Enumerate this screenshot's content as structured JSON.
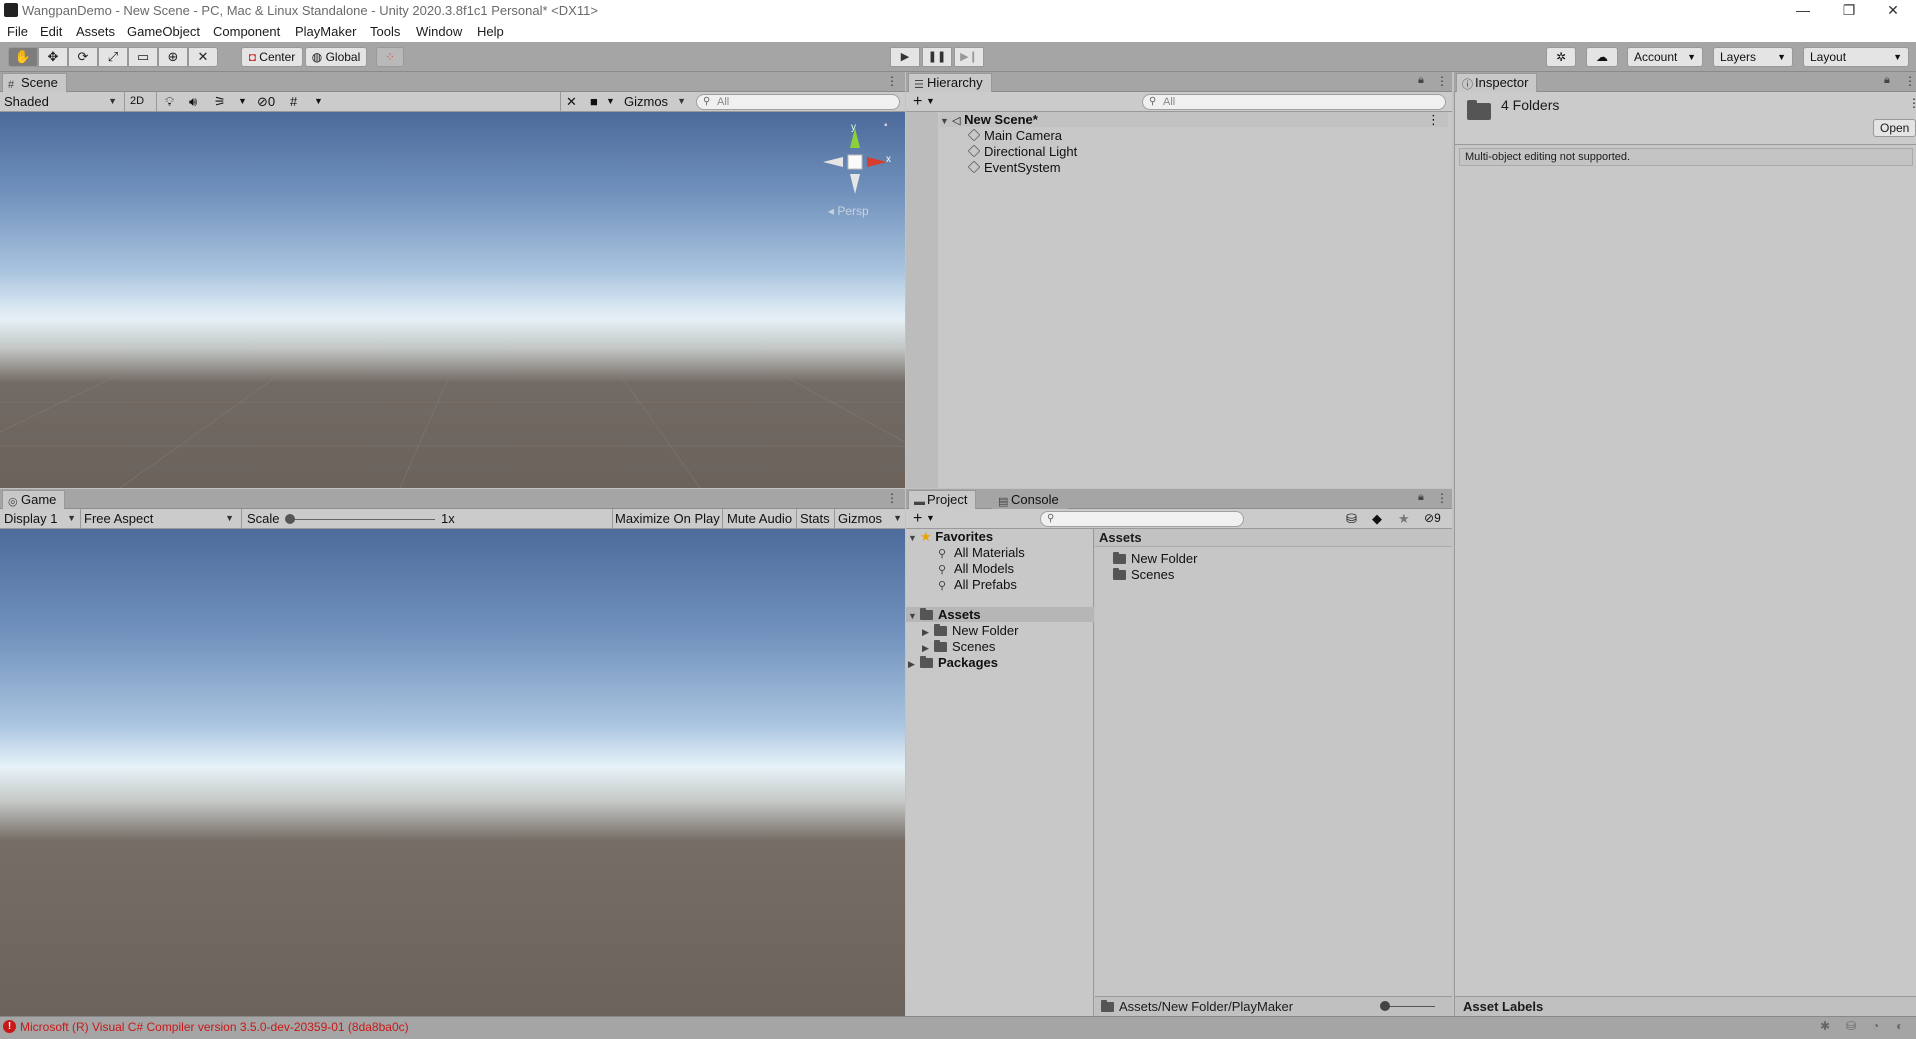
{
  "window": {
    "title": "WangpanDemo - New Scene - PC, Mac & Linux Standalone - Unity 2020.3.8f1c1 Personal* <DX11>",
    "minimize": "—",
    "restore": "❐",
    "close": "✕"
  },
  "menu": [
    "File",
    "Edit",
    "Assets",
    "GameObject",
    "Component",
    "PlayMaker",
    "Tools",
    "Window",
    "Help"
  ],
  "toolbar": {
    "tools": [
      "hand-icon",
      "move-icon",
      "rotate-icon",
      "scale-icon",
      "rect-icon",
      "transform-icon",
      "custom-tool-icon"
    ],
    "pivot_label": "Center",
    "space_label": "Global",
    "account_label": "Account",
    "layers_label": "Layers",
    "layout_label": "Layout"
  },
  "scene": {
    "tab_label": "Scene",
    "shading_mode": "Shaded",
    "mode_2d": "2D",
    "hidden_count": "0",
    "gizmos_label": "Gizmos",
    "search_placeholder": "All",
    "persp_label": "Persp",
    "axis_y": "y",
    "axis_x": "x"
  },
  "game": {
    "tab_label": "Game",
    "display": "Display 1",
    "aspect": "Free Aspect",
    "scale_label": "Scale",
    "scale_value": "1x",
    "scale_fraction": 0,
    "maximize_label": "Maximize On Play",
    "mute_label": "Mute Audio",
    "stats_label": "Stats",
    "gizmos_label": "Gizmos"
  },
  "hierarchy": {
    "tab_label": "Hierarchy",
    "search_placeholder": "All",
    "scene_name": "New Scene*",
    "items": [
      "Main Camera",
      "Directional Light",
      "EventSystem"
    ]
  },
  "project": {
    "tab_label": "Project",
    "console_tab_label": "Console",
    "hidden_count": "9",
    "favorites_label": "Favorites",
    "favorites": [
      "All Materials",
      "All Models",
      "All Prefabs"
    ],
    "assets_label": "Assets",
    "asset_folders": [
      "New Folder",
      "Scenes"
    ],
    "packages_label": "Packages",
    "content_header": "Assets",
    "content_items": [
      "New Folder",
      "Scenes"
    ],
    "path": "Assets/New Folder/PlayMaker"
  },
  "inspector": {
    "tab_label": "Inspector",
    "selection_title": "4 Folders",
    "open_button": "Open",
    "message": "Multi-object editing not supported.",
    "asset_labels": "Asset Labels"
  },
  "status": {
    "error_text": "Microsoft (R) Visual C# Compiler version 3.5.0-dev-20359-01 (8da8ba0c)",
    "error_color": "#c81818"
  }
}
